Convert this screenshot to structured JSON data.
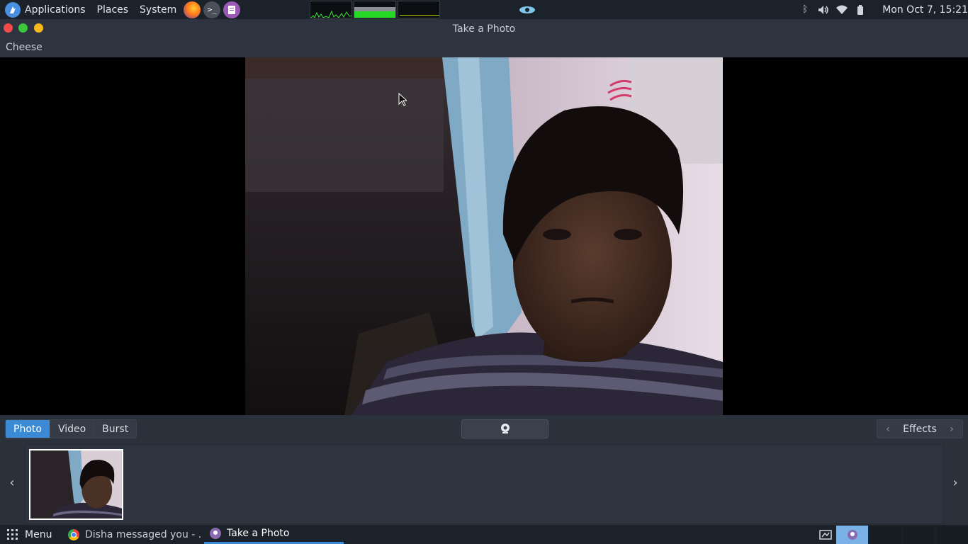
{
  "top_panel": {
    "menus": [
      "Applications",
      "Places",
      "System"
    ],
    "launchers": [
      "firefox-icon",
      "terminal-icon",
      "text-editor-icon"
    ],
    "clock": "Mon Oct  7, 15:21"
  },
  "window": {
    "title": "Take a Photo",
    "app_menu": "Cheese"
  },
  "toolbar": {
    "modes": [
      "Photo",
      "Video",
      "Burst"
    ],
    "active_mode": "Photo",
    "effects_label": "Effects"
  },
  "taskbar": {
    "menu_label": "Menu",
    "tasks": [
      {
        "label": "Disha messaged you - ...",
        "icon": "chrome-icon"
      },
      {
        "label": "Take a Photo",
        "icon": "cheese-icon"
      }
    ]
  },
  "colors": {
    "accent": "#3b8ad6",
    "panel": "#1c222a",
    "window_chrome": "#2d3440"
  }
}
